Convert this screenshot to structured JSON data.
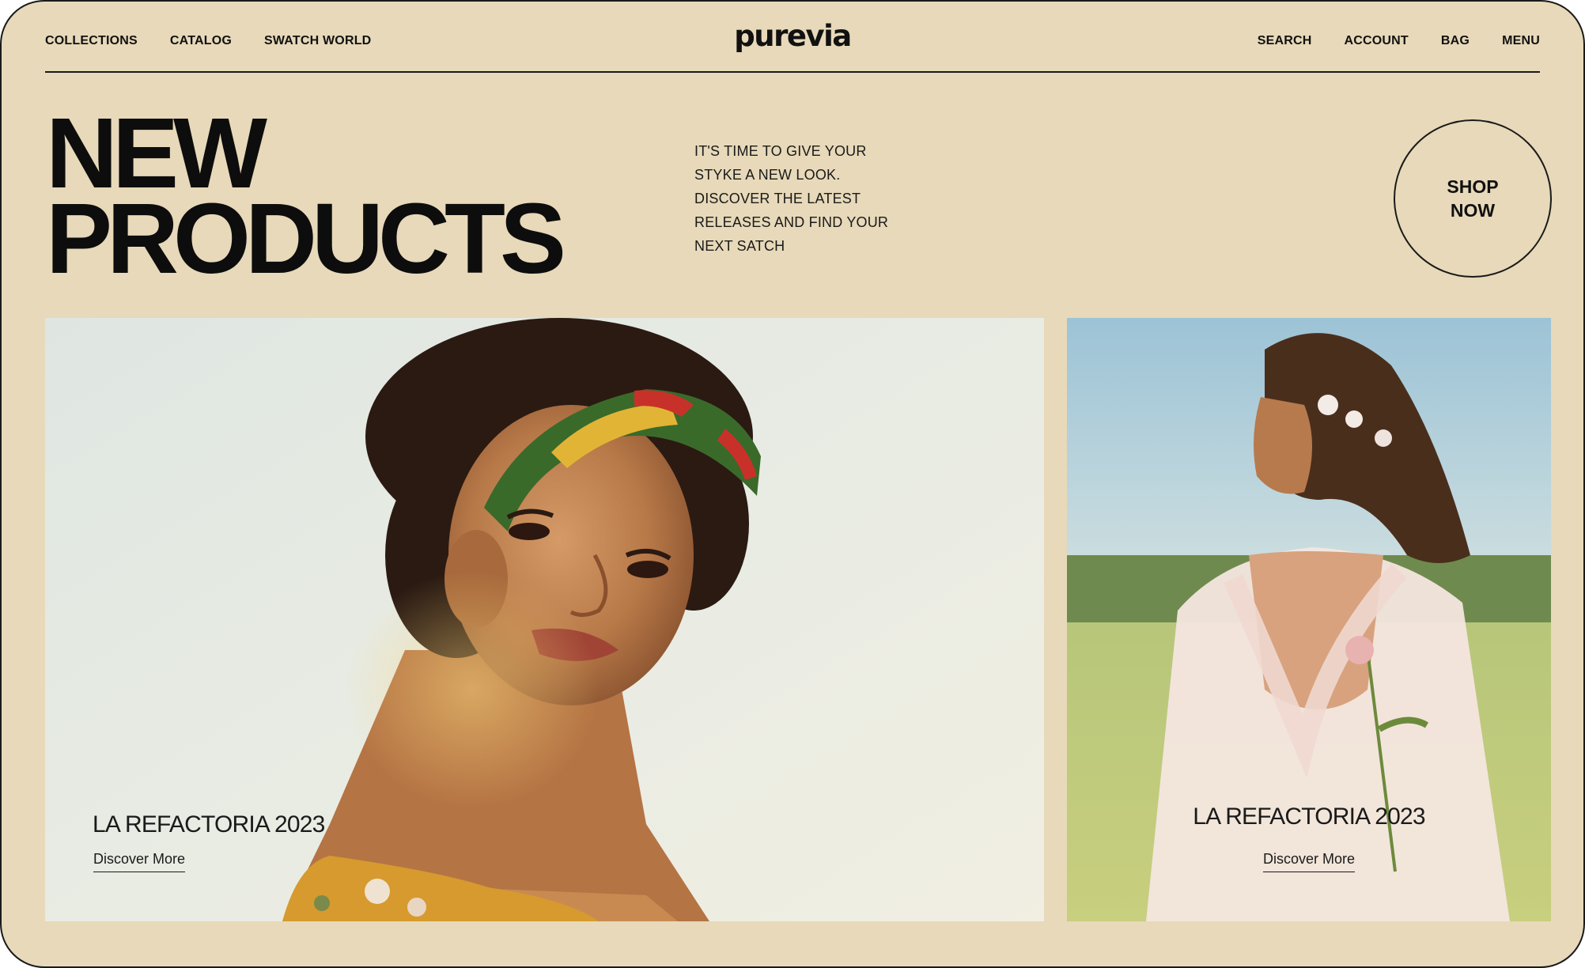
{
  "brand": {
    "logo": "purevia"
  },
  "nav": {
    "left": [
      "COLLECTIONS",
      "CATALOG",
      "SWATCH WORLD"
    ],
    "right": [
      "SEARCH",
      "ACCOUNT",
      "BAG",
      "MENU"
    ]
  },
  "hero": {
    "title_line1": "NEW",
    "title_line2": "PRODUCTS",
    "tagline": [
      "IT'S TIME TO GIVE YOUR",
      "STYKE A NEW LOOK.",
      "DISCOVER THE LATEST",
      "RELEASES AND FIND YOUR",
      "NEXT SATCH"
    ],
    "shop_button": {
      "line1": "SHOP",
      "line2": "NOW"
    }
  },
  "cards": [
    {
      "title": "LA REFACTORIA 2023",
      "link": "Discover More",
      "image": "woman-headband-portrait"
    },
    {
      "title": "LA REFACTORIA 2023",
      "link": "Discover More",
      "image": "woman-white-dress-field"
    }
  ],
  "colors": {
    "background": "#e7d9b9",
    "text": "#111111",
    "line": "#1a1a1a"
  }
}
